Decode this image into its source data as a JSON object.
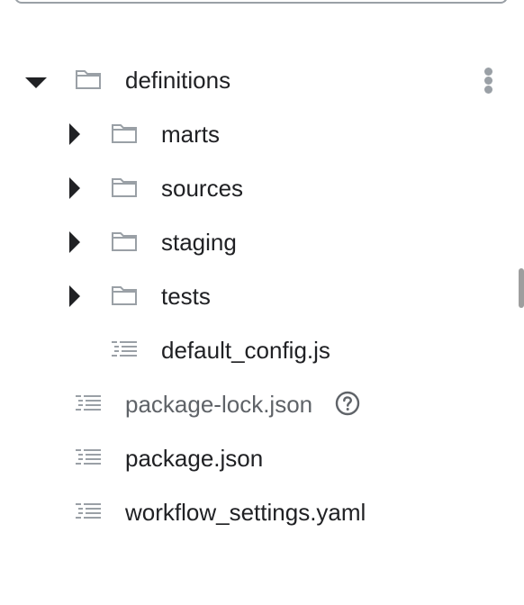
{
  "tree": {
    "root": {
      "label": "definitions",
      "expanded": true
    },
    "children": [
      {
        "label": "marts",
        "type": "folder"
      },
      {
        "label": "sources",
        "type": "folder"
      },
      {
        "label": "staging",
        "type": "folder"
      },
      {
        "label": "tests",
        "type": "folder"
      },
      {
        "label": "default_config.js",
        "type": "file"
      }
    ],
    "files": [
      {
        "label": "package-lock.json",
        "type": "file"
      },
      {
        "label": "package.json",
        "type": "file"
      },
      {
        "label": "workflow_settings.yaml",
        "type": "file"
      }
    ]
  },
  "icons": {
    "folder": "folder-icon",
    "file": "file-list-icon",
    "help": "help-circle-icon",
    "more": "more-vert-icon",
    "expanded": "chevron-down-icon",
    "collapsed": "chevron-right-icon"
  },
  "colors": {
    "text": "#202124",
    "muted_text": "#5f6368",
    "icon_gray": "#9aa0a6"
  }
}
